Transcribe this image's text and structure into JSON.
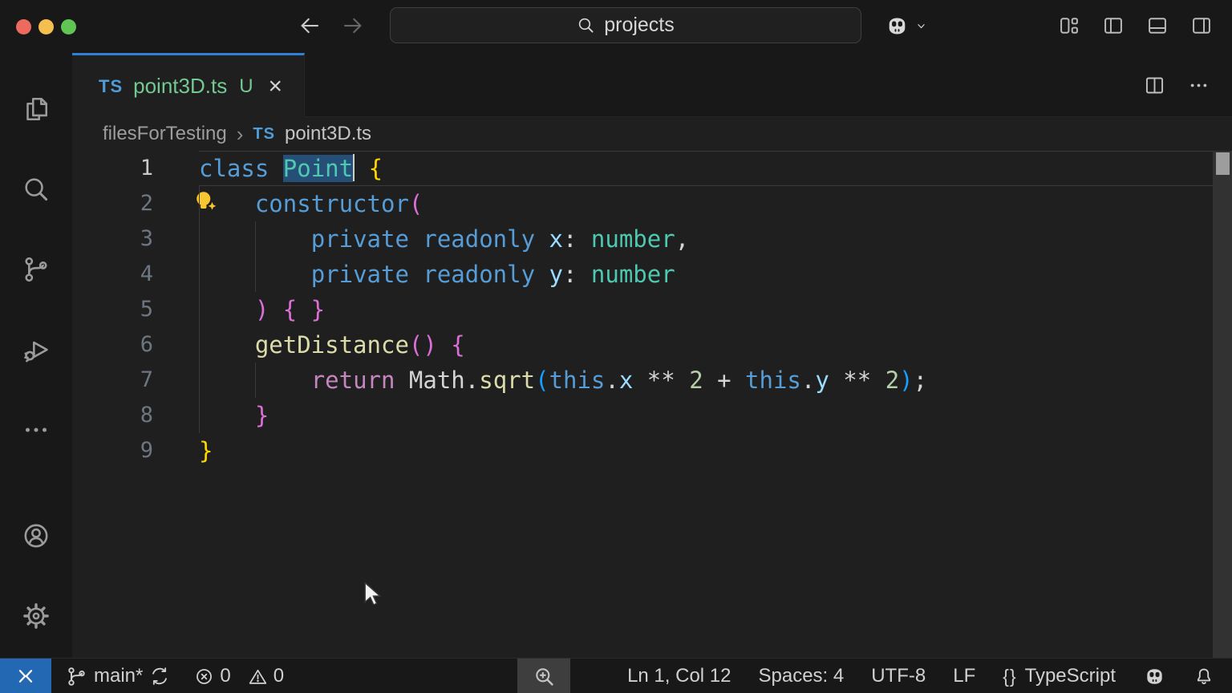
{
  "titlebar": {
    "traffic_lights": [
      "#ED6A5E",
      "#F5BF4F",
      "#61C554"
    ],
    "command_center": {
      "value": "projects",
      "icon": "search-icon"
    },
    "right_icons": [
      "customize-layout-icon",
      "toggle-sidebar-left-icon",
      "toggle-panel-bottom-icon",
      "toggle-sidebar-right-icon"
    ]
  },
  "activity_bar": {
    "top_items": [
      {
        "name": "explorer",
        "icon": "files-icon"
      },
      {
        "name": "search",
        "icon": "search-icon"
      },
      {
        "name": "source-control",
        "icon": "source-control-icon"
      },
      {
        "name": "run-and-debug",
        "icon": "debug-icon"
      },
      {
        "name": "more-views",
        "icon": "ellipsis-icon"
      }
    ],
    "bottom_items": [
      {
        "name": "accounts",
        "icon": "account-icon"
      },
      {
        "name": "settings",
        "icon": "gear-icon"
      }
    ]
  },
  "tab": {
    "badge": "TS",
    "title": "point3D.ts",
    "git_status": "U",
    "close": "×"
  },
  "breadcrumb": {
    "folder": "filesForTesting",
    "separator": "›",
    "file_badge": "TS",
    "file": "point3D.ts"
  },
  "editor": {
    "syntax_colors": {
      "keyword": "#569CD6",
      "type": "#4EC9B0",
      "variable": "#9CDCFE",
      "function": "#DCDCAA",
      "control": "#C586C0",
      "number": "#B5CEA8",
      "plain": "#D4D4D4",
      "bracket1": "#FFD700",
      "bracket2": "#DA70D6",
      "bracket3": "#179FFF"
    },
    "selection_color": "#264F78",
    "lines": [
      {
        "num": "1",
        "current": true,
        "guides": [],
        "segments": [
          {
            "t": "class",
            "c": "keyword"
          },
          {
            "t": " ",
            "c": "plain"
          },
          {
            "t": "Point",
            "c": "type",
            "sel": true,
            "caret": true
          },
          {
            "t": " ",
            "c": "plain"
          },
          {
            "t": "{",
            "c": "bracket1"
          }
        ]
      },
      {
        "num": "2",
        "guides": [
          0
        ],
        "lightbulb": true,
        "segments": [
          {
            "t": "    ",
            "c": "plain"
          },
          {
            "t": "constructor",
            "c": "keyword"
          },
          {
            "t": "(",
            "c": "bracket2"
          }
        ]
      },
      {
        "num": "3",
        "guides": [
          0,
          4
        ],
        "segments": [
          {
            "t": "        ",
            "c": "plain"
          },
          {
            "t": "private",
            "c": "keyword"
          },
          {
            "t": " ",
            "c": "plain"
          },
          {
            "t": "readonly",
            "c": "keyword"
          },
          {
            "t": " ",
            "c": "plain"
          },
          {
            "t": "x",
            "c": "variable"
          },
          {
            "t": ": ",
            "c": "plain"
          },
          {
            "t": "number",
            "c": "type"
          },
          {
            "t": ",",
            "c": "plain"
          }
        ]
      },
      {
        "num": "4",
        "guides": [
          0,
          4
        ],
        "segments": [
          {
            "t": "        ",
            "c": "plain"
          },
          {
            "t": "private",
            "c": "keyword"
          },
          {
            "t": " ",
            "c": "plain"
          },
          {
            "t": "readonly",
            "c": "keyword"
          },
          {
            "t": " ",
            "c": "plain"
          },
          {
            "t": "y",
            "c": "variable"
          },
          {
            "t": ": ",
            "c": "plain"
          },
          {
            "t": "number",
            "c": "type"
          }
        ]
      },
      {
        "num": "5",
        "guides": [
          0
        ],
        "segments": [
          {
            "t": "    ",
            "c": "plain"
          },
          {
            "t": ") { }",
            "c": "bracket2"
          }
        ]
      },
      {
        "num": "6",
        "guides": [
          0
        ],
        "segments": [
          {
            "t": "    ",
            "c": "plain"
          },
          {
            "t": "getDistance",
            "c": "function"
          },
          {
            "t": "()",
            "c": "bracket2"
          },
          {
            "t": " ",
            "c": "plain"
          },
          {
            "t": "{",
            "c": "bracket2"
          }
        ]
      },
      {
        "num": "7",
        "guides": [
          0,
          4
        ],
        "segments": [
          {
            "t": "        ",
            "c": "plain"
          },
          {
            "t": "return",
            "c": "control"
          },
          {
            "t": " ",
            "c": "plain"
          },
          {
            "t": "Math",
            "c": "plain"
          },
          {
            "t": ".",
            "c": "plain"
          },
          {
            "t": "sqrt",
            "c": "function"
          },
          {
            "t": "(",
            "c": "bracket3"
          },
          {
            "t": "this",
            "c": "keyword"
          },
          {
            "t": ".",
            "c": "plain"
          },
          {
            "t": "x",
            "c": "variable"
          },
          {
            "t": " ",
            "c": "plain"
          },
          {
            "t": "**",
            "c": "plain"
          },
          {
            "t": " ",
            "c": "plain"
          },
          {
            "t": "2",
            "c": "number"
          },
          {
            "t": " + ",
            "c": "plain"
          },
          {
            "t": "this",
            "c": "keyword"
          },
          {
            "t": ".",
            "c": "plain"
          },
          {
            "t": "y",
            "c": "variable"
          },
          {
            "t": " ",
            "c": "plain"
          },
          {
            "t": "**",
            "c": "plain"
          },
          {
            "t": " ",
            "c": "plain"
          },
          {
            "t": "2",
            "c": "number"
          },
          {
            "t": ")",
            "c": "bracket3"
          },
          {
            "t": ";",
            "c": "plain"
          }
        ]
      },
      {
        "num": "8",
        "guides": [
          0
        ],
        "segments": [
          {
            "t": "    ",
            "c": "plain"
          },
          {
            "t": "}",
            "c": "bracket2"
          }
        ]
      },
      {
        "num": "9",
        "guides": [],
        "segments": [
          {
            "t": "}",
            "c": "bracket1"
          }
        ]
      }
    ]
  },
  "status_bar": {
    "branch_label": "main*",
    "errors": "0",
    "warnings": "0",
    "cursor_position": "Ln 1, Col 12",
    "indentation": "Spaces: 4",
    "encoding": "UTF-8",
    "eol": "LF",
    "language_braces": "{}",
    "language": "TypeScript"
  }
}
